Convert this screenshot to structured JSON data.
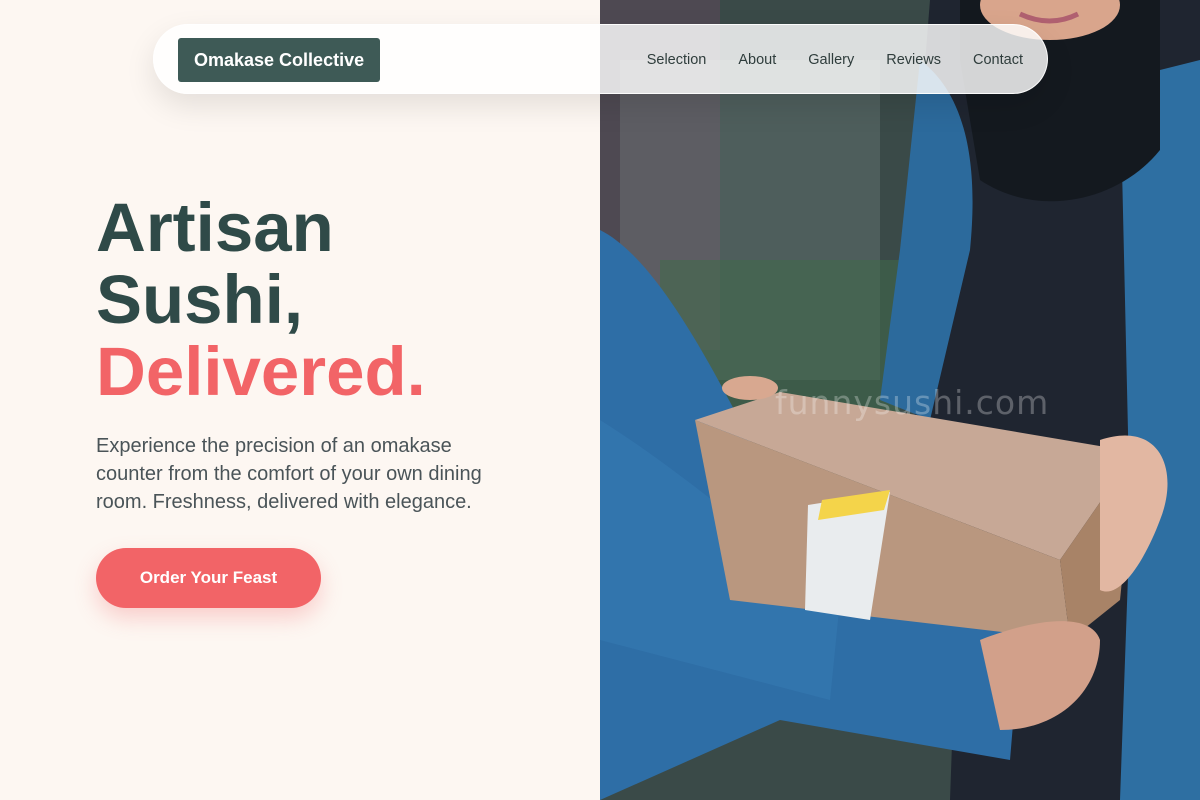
{
  "brand": {
    "name": "Omakase Collective"
  },
  "nav": {
    "links": [
      "Selection",
      "About",
      "Gallery",
      "Reviews",
      "Contact"
    ]
  },
  "hero": {
    "headline_line1": "Artisan",
    "headline_line2": "Sushi,",
    "headline_accent": "Delivered.",
    "subtext": "Experience the precision of an omakase counter from the comfort of your own dining room. Freshness, delivered with elegance.",
    "cta_label": "Order Your Feast",
    "watermark": "funnysushi.com"
  },
  "colors": {
    "primary_dark": "#2f4a48",
    "brand_bg": "#3e5a56",
    "accent": "#f26467",
    "cream": "#fdf7f2"
  }
}
